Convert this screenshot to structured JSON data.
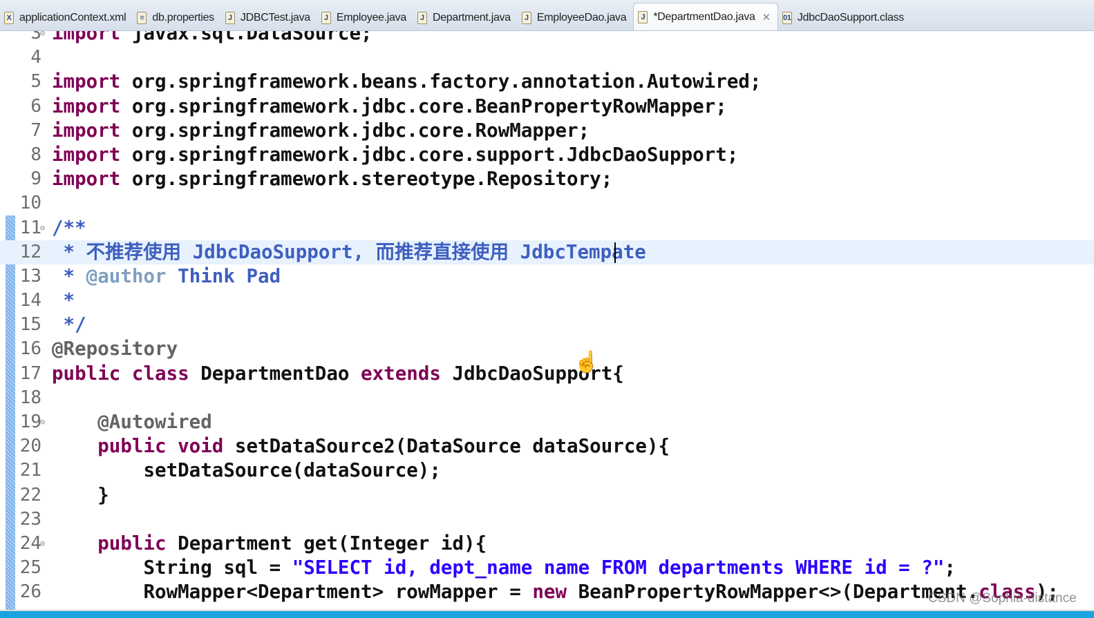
{
  "tabs": [
    {
      "label": "applicationContext.xml",
      "icon": "xml-file-icon",
      "glyph": "X"
    },
    {
      "label": "db.properties",
      "icon": "properties-file-icon",
      "glyph": "≡"
    },
    {
      "label": "JDBCTest.java",
      "icon": "java-file-icon",
      "glyph": "J"
    },
    {
      "label": "Employee.java",
      "icon": "java-file-icon",
      "glyph": "J"
    },
    {
      "label": "Department.java",
      "icon": "java-file-icon",
      "glyph": "J"
    },
    {
      "label": "EmployeeDao.java",
      "icon": "java-file-icon",
      "glyph": "J"
    },
    {
      "label": "*DepartmentDao.java",
      "icon": "java-file-icon",
      "glyph": "J",
      "active": true
    },
    {
      "label": "JdbcDaoSupport.class",
      "icon": "class-file-icon",
      "glyph": "01"
    }
  ],
  "colors": {
    "keyword": "#7f0055",
    "string": "#2a00ff",
    "javadoc": "#3f5fbf",
    "annotation": "#646464",
    "current_line": "#e8f2fe"
  },
  "lines": [
    {
      "n": "3",
      "fold": true,
      "t": [
        [
          "kw",
          "import"
        ],
        [
          "pl",
          " javax.sql.DataSource;"
        ]
      ]
    },
    {
      "n": "4",
      "t": []
    },
    {
      "n": "5",
      "t": [
        [
          "kw",
          "import"
        ],
        [
          "pl",
          " org.springframework.beans.factory.annotation.Autowired;"
        ]
      ]
    },
    {
      "n": "6",
      "t": [
        [
          "kw",
          "import"
        ],
        [
          "pl",
          " org.springframework.jdbc.core.BeanPropertyRowMapper;"
        ]
      ]
    },
    {
      "n": "7",
      "t": [
        [
          "kw",
          "import"
        ],
        [
          "pl",
          " org.springframework.jdbc.core.RowMapper;"
        ]
      ]
    },
    {
      "n": "8",
      "t": [
        [
          "kw",
          "import"
        ],
        [
          "pl",
          " org.springframework.jdbc.core.support.JdbcDaoSupport;"
        ]
      ]
    },
    {
      "n": "9",
      "t": [
        [
          "kw",
          "import"
        ],
        [
          "pl",
          " org.springframework.stereotype.Repository;"
        ]
      ]
    },
    {
      "n": "10",
      "t": []
    },
    {
      "n": "11",
      "fold": true,
      "t": [
        [
          "doc",
          "/**"
        ]
      ]
    },
    {
      "n": "12",
      "current": true,
      "t": [
        [
          "doc",
          " * 不推荐使用 JdbcDaoSupport, 而推荐直接使用 JdbcTempate "
        ]
      ]
    },
    {
      "n": "13",
      "t": [
        [
          "doc",
          " * "
        ],
        [
          "tag",
          "@author"
        ],
        [
          "doc",
          " Think Pad"
        ]
      ]
    },
    {
      "n": "14",
      "t": [
        [
          "doc",
          " *"
        ]
      ]
    },
    {
      "n": "15",
      "t": [
        [
          "doc",
          " */"
        ]
      ]
    },
    {
      "n": "16",
      "t": [
        [
          "ann",
          "@Repository"
        ]
      ]
    },
    {
      "n": "17",
      "t": [
        [
          "kw",
          "public class"
        ],
        [
          "pl",
          " DepartmentDao "
        ],
        [
          "kw",
          "extends"
        ],
        [
          "pl",
          " JdbcDaoSupport{"
        ]
      ]
    },
    {
      "n": "18",
      "t": []
    },
    {
      "n": "19",
      "fold": true,
      "t": [
        [
          "ann",
          "    @Autowired"
        ]
      ]
    },
    {
      "n": "20",
      "t": [
        [
          "pl",
          "    "
        ],
        [
          "kw",
          "public void"
        ],
        [
          "pl",
          " setDataSource2(DataSource dataSource){"
        ]
      ]
    },
    {
      "n": "21",
      "t": [
        [
          "pl",
          "        setDataSource(dataSource);"
        ]
      ]
    },
    {
      "n": "22",
      "t": [
        [
          "pl",
          "    }"
        ]
      ]
    },
    {
      "n": "23",
      "t": []
    },
    {
      "n": "24",
      "fold": true,
      "t": [
        [
          "pl",
          "    "
        ],
        [
          "kw",
          "public"
        ],
        [
          "pl",
          " Department get(Integer id){"
        ]
      ]
    },
    {
      "n": "25",
      "t": [
        [
          "pl",
          "        String sql = "
        ],
        [
          "str",
          "\"SELECT id, dept_name name FROM departments WHERE id = ?\""
        ],
        [
          "pl",
          ";"
        ]
      ]
    },
    {
      "n": "26",
      "t": [
        [
          "pl",
          "        RowMapper<Department> rowMapper = "
        ],
        [
          "kw",
          "new"
        ],
        [
          "pl",
          " BeanPropertyRowMapper<>(Department."
        ],
        [
          "kw",
          "class"
        ],
        [
          "pl",
          ");"
        ]
      ]
    }
  ],
  "watermark": "CSDN @Sophia-distance"
}
